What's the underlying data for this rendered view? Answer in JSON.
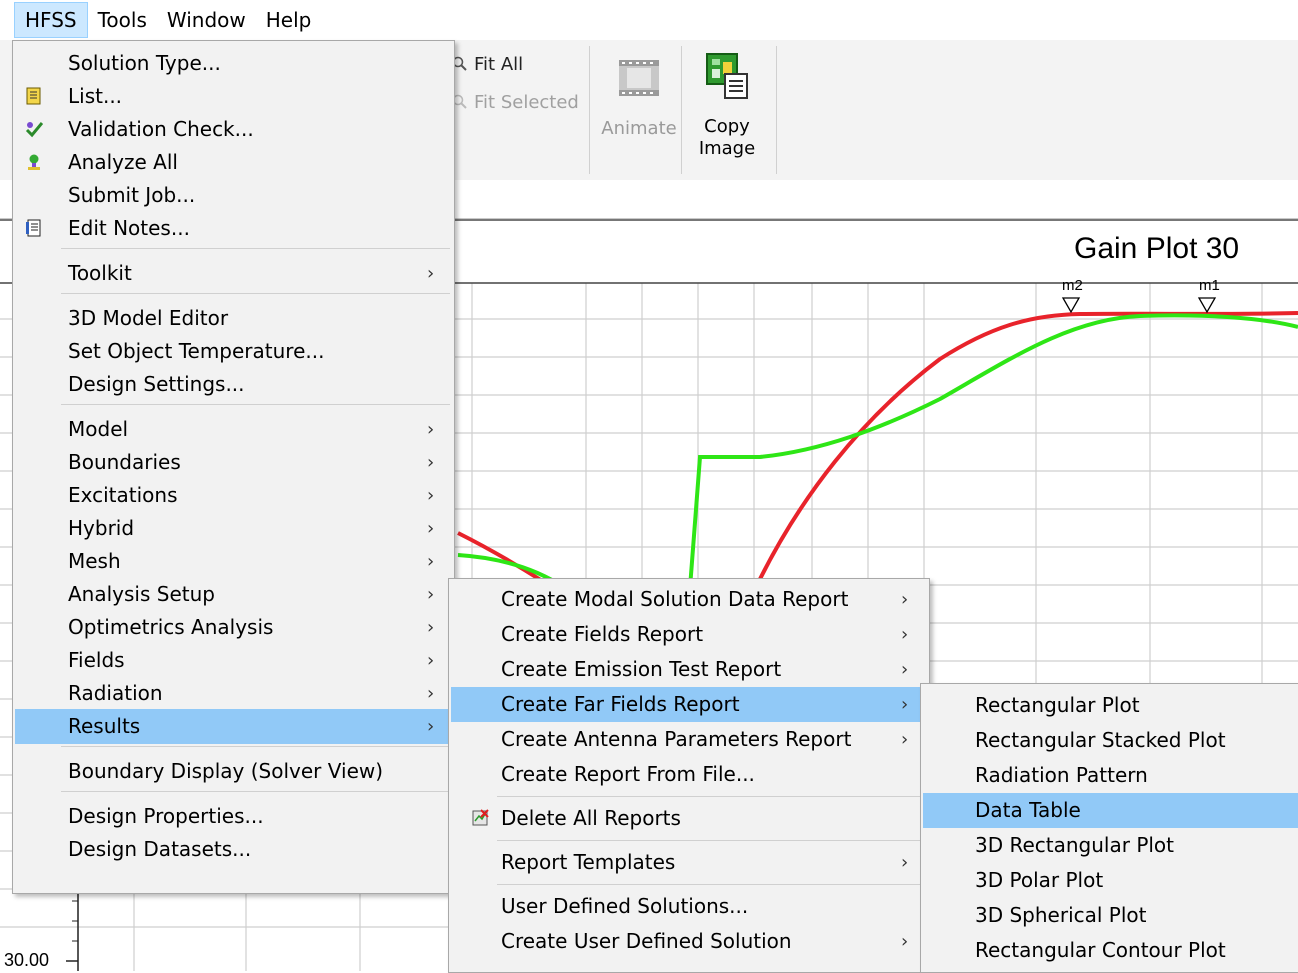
{
  "menubar": {
    "items": [
      "HFSS",
      "Tools",
      "Window",
      "Help"
    ]
  },
  "toolbar": {
    "fit_all": "Fit All",
    "fit_selected": "Fit Selected",
    "animate": "Animate",
    "copy_image_line1": "Copy",
    "copy_image_line2": "Image"
  },
  "plot": {
    "title": "Gain Plot 30",
    "y_tick_label": "30.00",
    "marker1": "m1",
    "marker2": "m2",
    "colors": {
      "series_red": "#e8232b",
      "series_green": "#2ee616"
    }
  },
  "hfss_menu": {
    "items": [
      {
        "label": "Solution Type...",
        "icon": "",
        "submenu": false
      },
      {
        "label": "List...",
        "icon": "list-icon",
        "submenu": false
      },
      {
        "label": "Validation Check...",
        "icon": "validation-check-icon",
        "submenu": false
      },
      {
        "label": "Analyze All",
        "icon": "analyze-all-icon",
        "submenu": false
      },
      {
        "label": "Submit Job...",
        "icon": "",
        "submenu": false
      },
      {
        "label": "Edit Notes...",
        "icon": "notes-icon",
        "submenu": false
      },
      {
        "label": "Toolkit",
        "submenu": true
      },
      {
        "label": "3D Model Editor",
        "submenu": false
      },
      {
        "label": "Set Object Temperature...",
        "submenu": false
      },
      {
        "label": "Design Settings...",
        "submenu": false
      },
      {
        "label": "Model",
        "submenu": true
      },
      {
        "label": "Boundaries",
        "submenu": true
      },
      {
        "label": "Excitations",
        "submenu": true
      },
      {
        "label": "Hybrid",
        "submenu": true
      },
      {
        "label": "Mesh",
        "submenu": true
      },
      {
        "label": "Analysis Setup",
        "submenu": true
      },
      {
        "label": "Optimetrics Analysis",
        "submenu": true
      },
      {
        "label": "Fields",
        "submenu": true
      },
      {
        "label": "Radiation",
        "submenu": true
      },
      {
        "label": "Results",
        "submenu": true,
        "highlighted": true
      },
      {
        "label": "Boundary Display (Solver View)",
        "submenu": false
      },
      {
        "label": "Design Properties...",
        "submenu": false
      },
      {
        "label": "Design Datasets...",
        "submenu": false
      }
    ]
  },
  "results_menu": {
    "items": [
      {
        "label": "Create Modal Solution Data Report",
        "submenu": true
      },
      {
        "label": "Create Fields Report",
        "submenu": true
      },
      {
        "label": "Create Emission Test Report",
        "submenu": true
      },
      {
        "label": "Create Far Fields Report",
        "submenu": true,
        "highlighted": true
      },
      {
        "label": "Create Antenna Parameters Report",
        "submenu": true
      },
      {
        "label": "Create Report From File...",
        "submenu": false
      },
      {
        "label": "Delete All Reports",
        "icon": "delete-reports-icon",
        "submenu": false
      },
      {
        "label": "Report Templates",
        "submenu": true
      },
      {
        "label": "User Defined Solutions...",
        "submenu": false
      },
      {
        "label": "Create User Defined Solution",
        "submenu": true
      }
    ]
  },
  "far_fields_menu": {
    "items": [
      {
        "label": "Rectangular Plot"
      },
      {
        "label": "Rectangular Stacked Plot"
      },
      {
        "label": "Radiation Pattern"
      },
      {
        "label": "Data Table",
        "highlighted": true
      },
      {
        "label": "3D Rectangular Plot"
      },
      {
        "label": "3D Polar Plot"
      },
      {
        "label": "3D Spherical Plot"
      },
      {
        "label": "Rectangular Contour Plot"
      }
    ]
  },
  "arrow_glyph": "›"
}
